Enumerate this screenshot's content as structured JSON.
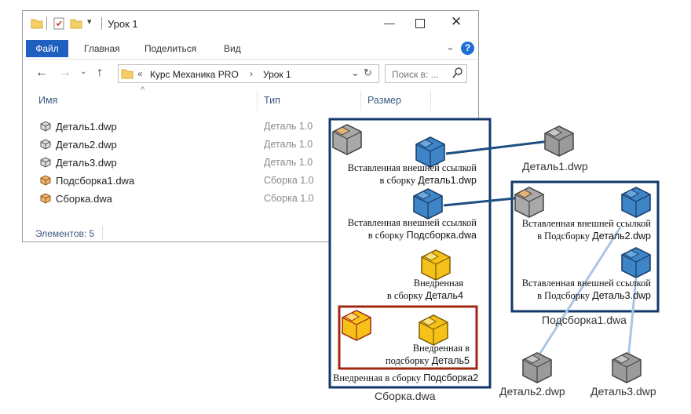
{
  "window": {
    "title": "Урок 1",
    "menu": {
      "file": "Файл",
      "home": "Главная",
      "share": "Поделиться",
      "view": "Вид"
    },
    "breadcrumb": {
      "prefix": "«",
      "parent": "Курс Механика PRO",
      "separator": "›",
      "current": "Урок 1"
    },
    "search_placeholder": "Поиск в: ...",
    "columns": {
      "name": "Имя",
      "type": "Тип",
      "size": "Размер"
    },
    "files": [
      {
        "name": "Деталь1.dwp",
        "type": "Деталь 1.0",
        "icon": "part-icon"
      },
      {
        "name": "Деталь2.dwp",
        "type": "Деталь 1.0",
        "icon": "part-icon"
      },
      {
        "name": "Деталь3.dwp",
        "type": "Деталь 1.0",
        "icon": "part-icon"
      },
      {
        "name": "Подсборка1.dwa",
        "type": "Сборка 1.0",
        "icon": "assembly-icon"
      },
      {
        "name": "Сборка.dwa",
        "type": "Сборка 1.0",
        "icon": "assembly-icon"
      }
    ],
    "status": "Элементов: 5"
  },
  "diagram": {
    "assembly": {
      "caption": "Сборка.dwa",
      "ext1": {
        "line1": "Вставленная внешней ссылкой",
        "line2_prefix": "в сборку",
        "line2_name": "Деталь1.dwp"
      },
      "ext2": {
        "line1": "Вставленная внешней ссылкой",
        "line2_prefix": "в сборку",
        "line2_name": "Подсборка.dwa"
      },
      "emb4": {
        "line1": "Внедренная",
        "line2_prefix": "в сборку",
        "line2_name": "Деталь4"
      },
      "sub2": {
        "line1": "Внедренная в",
        "line2_prefix": "подсборку",
        "line2_name": "Деталь5",
        "footer_prefix": "Внедренная в сборку",
        "footer_name": "Подсборка2"
      }
    },
    "subassembly": {
      "caption": "Подсборка1.dwa",
      "ext1": {
        "line1": "Вставленная внешней ссылкой",
        "line2_prefix": "в Подсборку",
        "line2_name": "Деталь2.dwp"
      },
      "ext2": {
        "line1": "Вставленная внешней ссылкой",
        "line2_prefix": "в Подсборку",
        "line2_name": "Деталь3.dwp"
      }
    },
    "parts": {
      "p1": "Деталь1.dwp",
      "p2": "Деталь2.dwp",
      "p3": "Деталь3.dwp"
    },
    "colors": {
      "frame_blue": "#12386b",
      "frame_red": "#a0280e",
      "link_blue": "#1d4f80",
      "link_light": "#a9c6e4",
      "blue_part": "#3d85c6",
      "gold_part": "#f6c21a",
      "gray_part": "#9b9b9b"
    }
  }
}
